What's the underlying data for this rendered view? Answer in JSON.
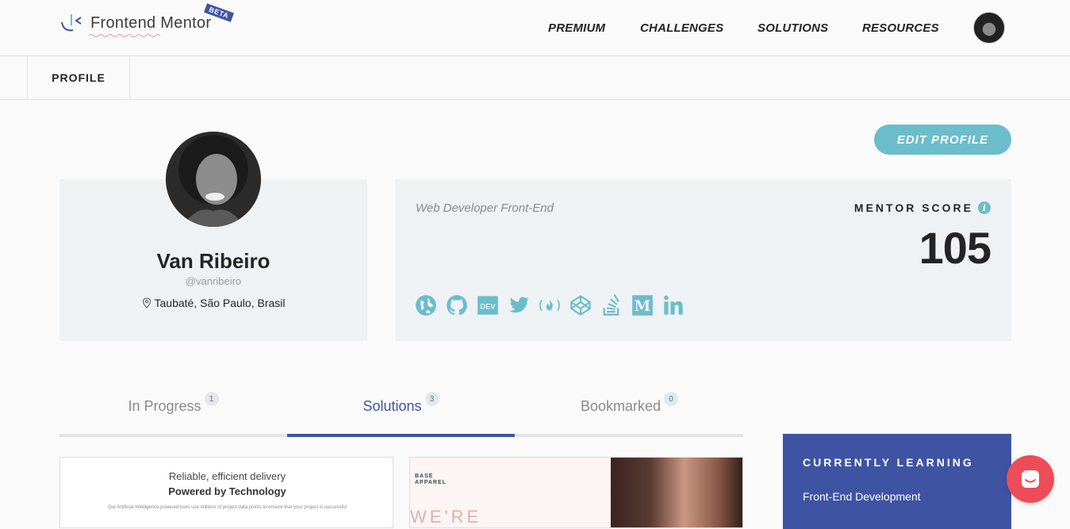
{
  "brand": {
    "name": "Frontend Mentor",
    "badge": "BETA"
  },
  "nav": {
    "premium": "PREMIUM",
    "challenges": "CHALLENGES",
    "solutions": "SOLUTIONS",
    "resources": "RESOURCES"
  },
  "subnav": {
    "profile": "PROFILE"
  },
  "actions": {
    "edit_profile": "EDIT PROFILE"
  },
  "profile": {
    "name": "Van Ribeiro",
    "handle": "@vanribeiro",
    "location": "Taubaté, São Paulo, Brasil",
    "bio": "Web Developer Front-End"
  },
  "score": {
    "label": "MENTOR SCORE",
    "value": "105"
  },
  "socials": [
    "globe-icon",
    "github-icon",
    "dev-icon",
    "twitter-icon",
    "freecodecamp-icon",
    "codepen-icon",
    "stackoverflow-icon",
    "medium-icon",
    "linkedin-icon"
  ],
  "tabs": [
    {
      "label": "In Progress",
      "count": "1"
    },
    {
      "label": "Solutions",
      "count": "3"
    },
    {
      "label": "Bookmarked",
      "count": "0"
    }
  ],
  "cards": {
    "card1": {
      "line1": "Reliable, efficient delivery",
      "line2": "Powered by Technology",
      "line3": "Our Artificial Intelligence powered tools use millions of project data points to ensure that your project is successful"
    },
    "card2": {
      "brand_line1": "BASE",
      "brand_line2": "APPAREL",
      "big": "WE'RE"
    }
  },
  "learning": {
    "title": "CURRENTLY LEARNING",
    "item": "Front-End Development"
  },
  "colors": {
    "accent": "#6bbdcc",
    "primary": "#3e54a3",
    "chat": "#ed4d58",
    "card_bg": "#eef2f4"
  }
}
